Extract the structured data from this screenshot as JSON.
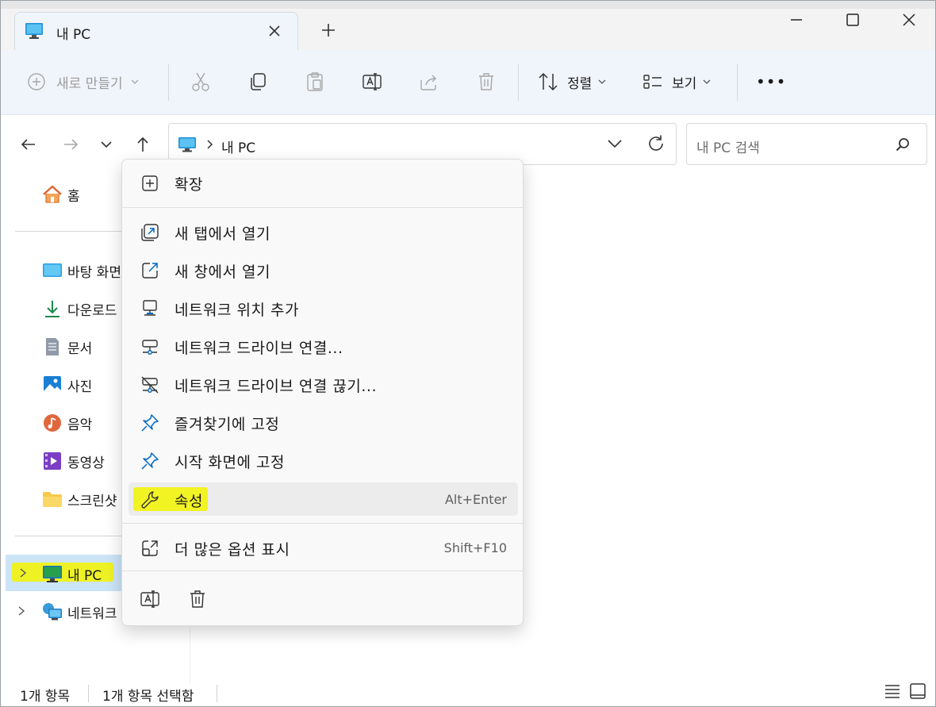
{
  "tab": {
    "title": "내 PC",
    "new_tab": "+"
  },
  "toolbar": {
    "new_label": "새로 만들기",
    "sort_label": "정렬",
    "view_label": "보기",
    "more_label": "•••"
  },
  "address": {
    "path_item": "내 PC"
  },
  "search": {
    "placeholder": "내 PC 검색"
  },
  "nav": {
    "home": "홈",
    "quick": [
      {
        "label": "바탕 화면",
        "icon": "desktop-icon"
      },
      {
        "label": "다운로드",
        "icon": "download-icon"
      },
      {
        "label": "문서",
        "icon": "document-icon"
      },
      {
        "label": "사진",
        "icon": "pictures-icon"
      },
      {
        "label": "음악",
        "icon": "music-icon"
      },
      {
        "label": "동영상",
        "icon": "video-icon"
      },
      {
        "label": "스크린샷",
        "icon": "folder-icon"
      }
    ],
    "this_pc": "내 PC",
    "network": "네트워크"
  },
  "context_menu": {
    "expand": "확장",
    "open_new_tab": "새 탭에서 열기",
    "open_new_window": "새 창에서 열기",
    "add_network_location": "네트워크 위치 추가",
    "map_network_drive": "네트워크 드라이브 연결...",
    "disconnect_network_drive": "네트워크 드라이브 연결 끊기...",
    "pin_quick_access": "즐겨찾기에 고정",
    "pin_start": "시작 화면에 고정",
    "properties": "속성",
    "properties_shortcut": "Alt+Enter",
    "more_options": "더 많은 옵션 표시",
    "more_options_shortcut": "Shift+F10"
  },
  "status": {
    "item_count": "1개 항목",
    "selected": "1개 항목 선택함"
  },
  "colors": {
    "accent": "#0067c0",
    "highlight": "#f3f500",
    "selected_bg": "#cce4f7"
  }
}
